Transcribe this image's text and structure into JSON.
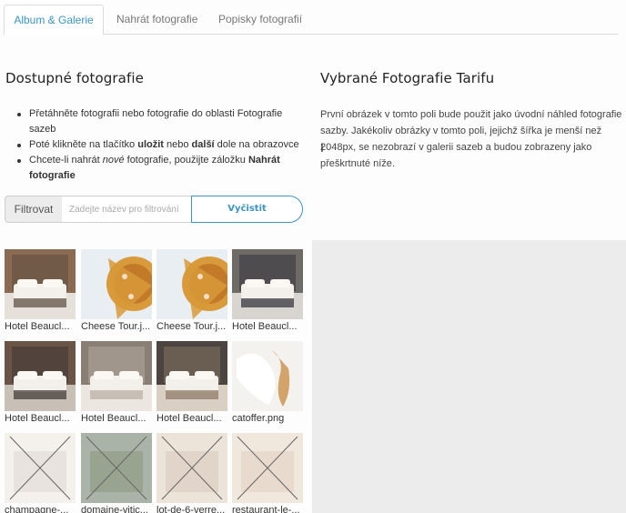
{
  "tabs": [
    {
      "label": "Album & Galerie",
      "active": true
    },
    {
      "label": "Nahrát fotografie",
      "active": false
    },
    {
      "label": "Popisky fotografií",
      "active": false
    }
  ],
  "left": {
    "title": "Dostupné fotografie",
    "instructions": [
      {
        "parts": [
          {
            "t": "Přetáhněte fotografii nebo fotografie do oblasti Fotografie sazeb",
            "s": "n"
          }
        ]
      },
      {
        "parts": [
          {
            "t": "Poté klikněte na tlačítko ",
            "s": "n"
          },
          {
            "t": "uložit",
            "s": "b"
          },
          {
            "t": " nebo ",
            "s": "n"
          },
          {
            "t": "další",
            "s": "b"
          },
          {
            "t": " dole na obrazovce",
            "s": "n"
          }
        ]
      },
      {
        "parts": [
          {
            "t": "Chcete-li nahrát ",
            "s": "n"
          },
          {
            "t": "nové",
            "s": "i"
          },
          {
            "t": " fotografie, použijte záložku ",
            "s": "n"
          },
          {
            "t": "Nahrát fotografie",
            "s": "b"
          }
        ]
      }
    ],
    "filter": {
      "label": "Filtrovat",
      "placeholder": "Zadejte název pro filtrování",
      "clear_label": "Vyčistit"
    },
    "photos": [
      {
        "caption": "Hotel Beaucl...",
        "kind": "room",
        "colors": [
          "#8a6a52",
          "#e6e0da",
          "#5a4a40"
        ]
      },
      {
        "caption": "Cheese Tour.j...",
        "kind": "cheese",
        "colors": [
          "#e8eef2",
          "#d89a3a",
          "#b5651d"
        ]
      },
      {
        "caption": "Cheese Tour.j...",
        "kind": "cheese",
        "colors": [
          "#e8eef2",
          "#d89a3a",
          "#b5651d"
        ]
      },
      {
        "caption": "Hotel Beaucl...",
        "kind": "room",
        "colors": [
          "#6e6a66",
          "#d8d4d0",
          "#2e2e36"
        ]
      },
      {
        "caption": "Hotel Beaucl...",
        "kind": "room",
        "colors": [
          "#6a5446",
          "#c8bfb6",
          "#3a3432"
        ]
      },
      {
        "caption": "Hotel Beaucl...",
        "kind": "room",
        "colors": [
          "#8a7f74",
          "#ebe6e0",
          "#b8aea4"
        ]
      },
      {
        "caption": "Hotel Beaucl...",
        "kind": "room",
        "colors": [
          "#4b4440",
          "#d9cfc3",
          "#8a7664"
        ]
      },
      {
        "caption": "catoffer.png",
        "kind": "cat",
        "colors": [
          "#f4f2ef",
          "#d2a46a",
          "#ffffff"
        ]
      },
      {
        "caption": "champagne-...",
        "kind": "x",
        "colors": [
          "#e9e4dd",
          "#b9b2a8",
          "#f4f1ec"
        ]
      },
      {
        "caption": "domaine-vitic...",
        "kind": "x",
        "colors": [
          "#b8c6cf",
          "#8d9a6e",
          "#5f6e4a"
        ]
      },
      {
        "caption": "lot-de-6-verre...",
        "kind": "x",
        "colors": [
          "#d8c6b2",
          "#b89e86",
          "#efe7dc"
        ]
      },
      {
        "caption": "restaurant-le-...",
        "kind": "x",
        "colors": [
          "#e0d0be",
          "#c9a88a",
          "#f2e9df"
        ]
      }
    ]
  },
  "right": {
    "title": "Vybrané Fotografie Tarifu",
    "description": "První obrázek v tomto poli bude použit jako úvodní náhled fotografie sazby. Jakékoliv obrázky v tomto poli, jejichž šířka je menší než 2048px, se nezobrazí v galerii sazeb a budou zobrazeny jako přeškrtnuté níže."
  },
  "colors": {
    "accent": "#3b95c4",
    "dropzone": "#ececec"
  }
}
